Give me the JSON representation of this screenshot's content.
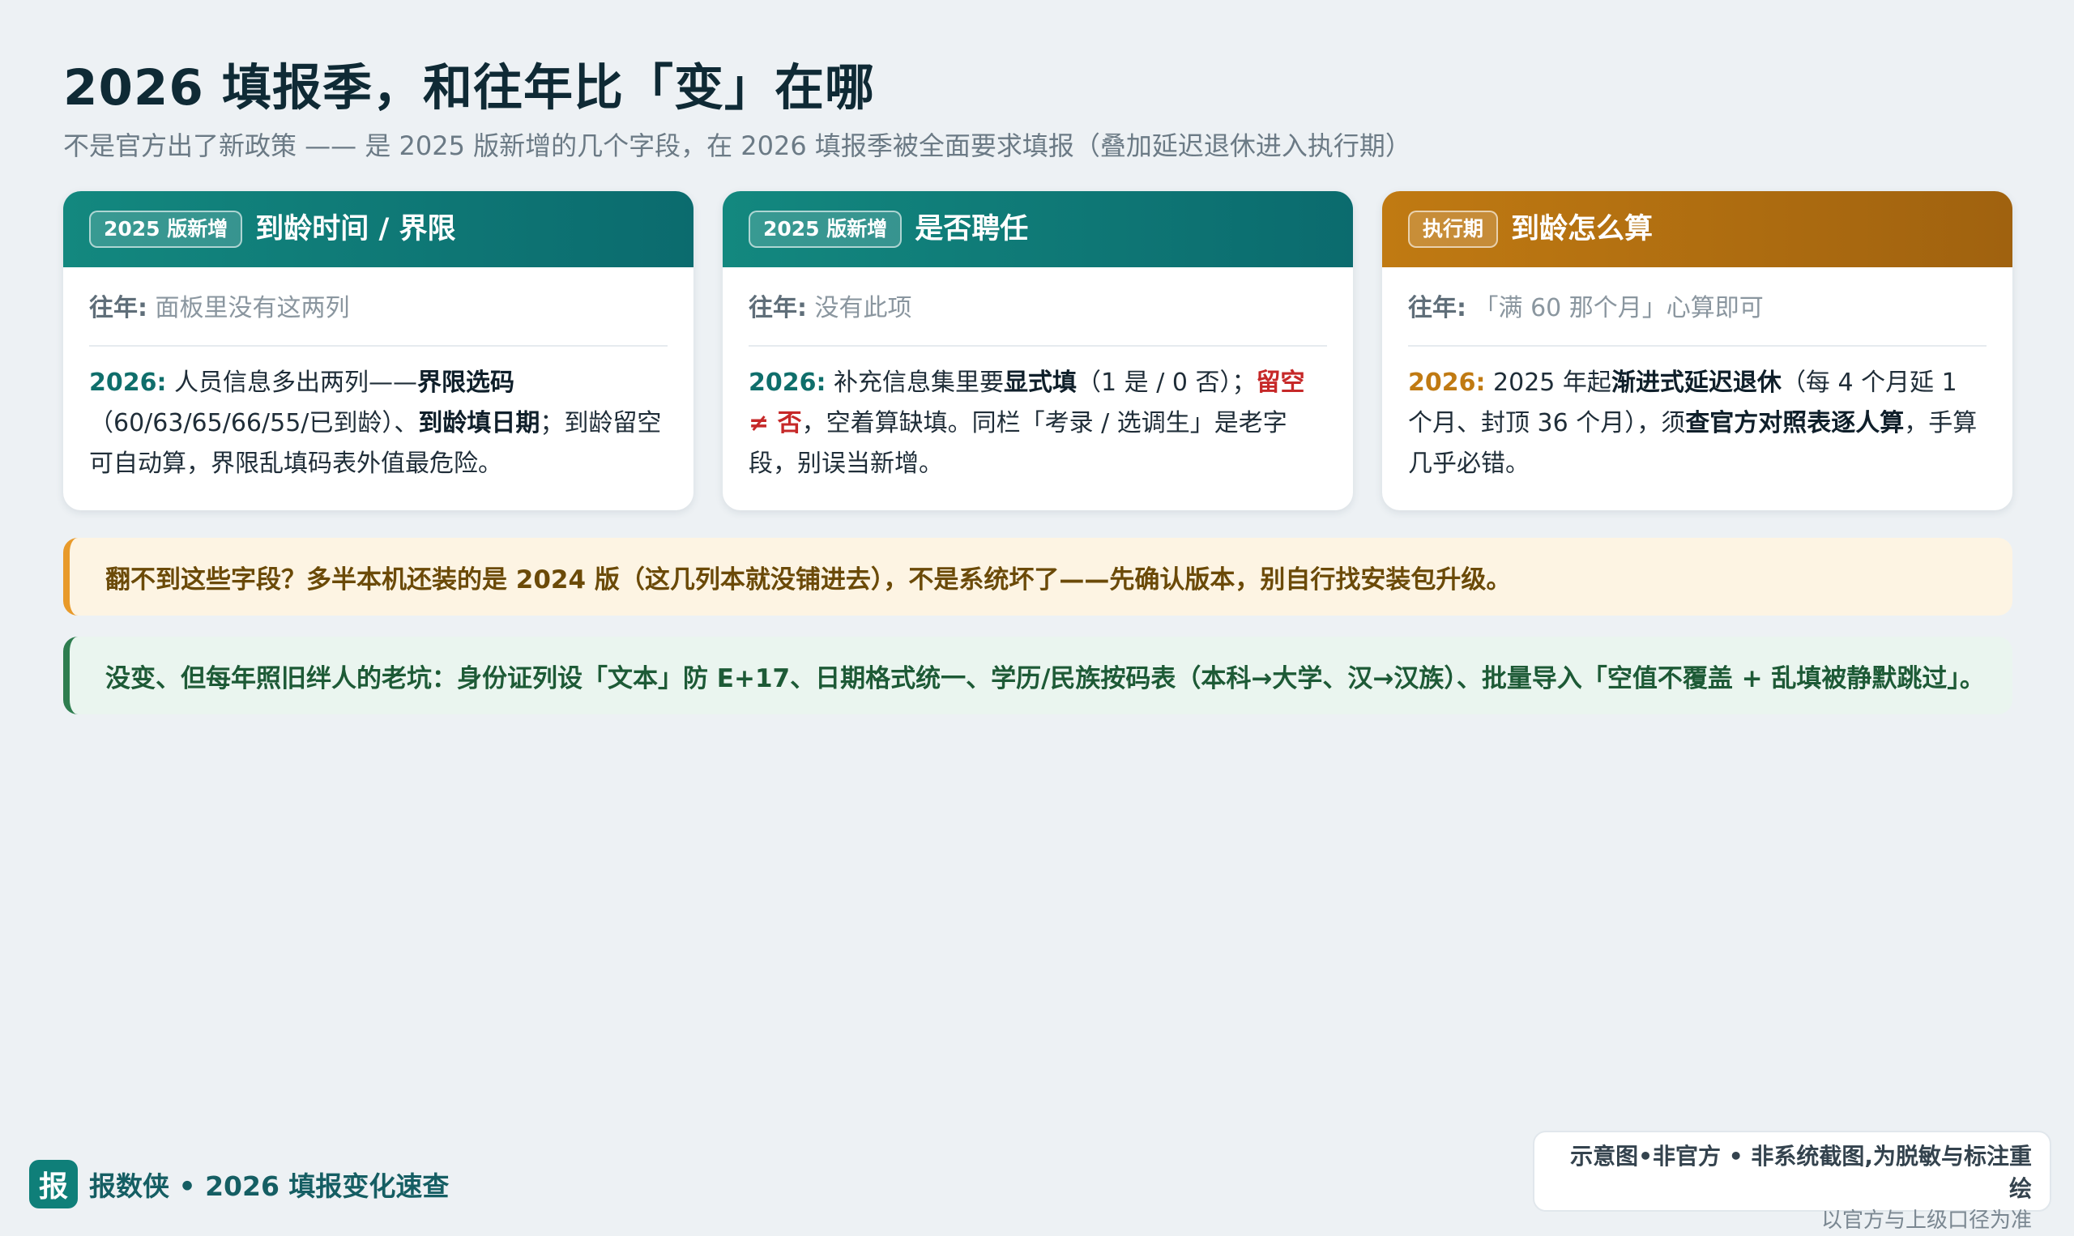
{
  "header": {
    "title": "2026 填报季，和往年比「变」在哪",
    "subtitle": "不是官方出了新政策 —— 是 2025 版新增的几个字段，在 2026 填报季被全面要求填报（叠加延迟退休进入执行期）"
  },
  "cards": [
    {
      "badge": "2025 版新增",
      "title": "到龄时间 / 界限",
      "prev_label": "往年:",
      "prev_text": "面板里没有这两列",
      "now_label": "2026:",
      "now_parts": [
        "人员信息多出两列——",
        "界限选码",
        "（60/63/65/66/55/已到龄）、",
        "到龄填日期",
        "；到龄留空可自动算，界限乱填码表外值最危险。"
      ]
    },
    {
      "badge": "2025 版新增",
      "title": "是否聘任",
      "prev_label": "往年:",
      "prev_text": "没有此项",
      "now_label": "2026:",
      "now_parts": [
        "补充信息集里要",
        "显式填",
        "（1 是 / 0 否）；",
        "留空 ≠ 否",
        "，空着算缺填。同栏「考录 / 选调生」是老字段，别误当新增。"
      ]
    },
    {
      "badge": "执行期",
      "title": "到龄怎么算",
      "prev_label": "往年:",
      "prev_text": "「满 60 那个月」心算即可",
      "now_label": "2026:",
      "now_parts": [
        "2025 年起",
        "渐进式延迟退休",
        "（每 4 个月延 1 个月、封顶 36 个月），须",
        "查官方对照表逐人算",
        "，手算几乎必错。"
      ]
    }
  ],
  "callouts": {
    "warning": "翻不到这些字段？多半本机还装的是 2024 版（这几列本就没铺进去），不是系统坏了——先确认版本，别自行找安装包升级。",
    "unchanged": "没变、但每年照旧绊人的老坑：身份证列设「文本」防 E+17、日期格式统一、学历/民族按码表（本科→大学、汉→汉族）、批量导入「空值不覆盖 + 乱填被静默跳过」。"
  },
  "footer": {
    "logo_char": "报",
    "brand": "报数侠 • 2026 填报变化速查",
    "disclaimer_main": "示意图•非官方 • 非系统截图,为脱敏与标注重绘",
    "disclaimer_sub": "以官方与上级口径为准"
  },
  "colors": {
    "teal": "#0f7f79",
    "amber": "#c07a12",
    "warning_accent": "#e89a2a",
    "ok_accent": "#2e7d4f",
    "alert_red": "#c62828"
  }
}
